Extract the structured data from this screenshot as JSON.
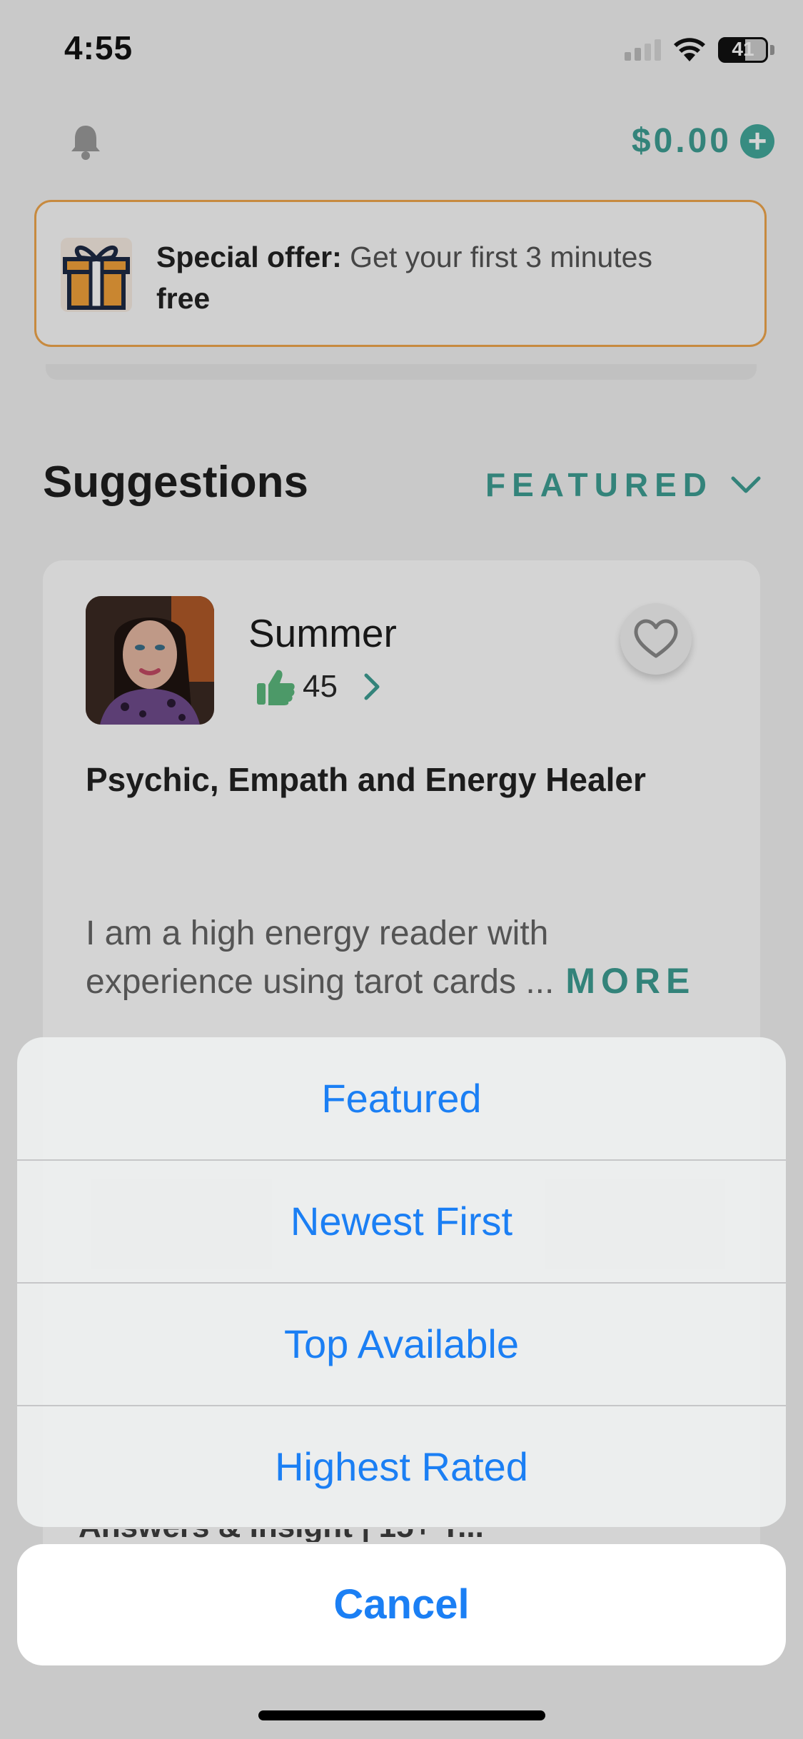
{
  "status_bar": {
    "time": "4:55",
    "battery": "41"
  },
  "header": {
    "balance": "$0.00"
  },
  "offer": {
    "label": "Special offer:",
    "text": "Get your first 3 minutes",
    "bold_end": "free"
  },
  "suggestions": {
    "title": "Suggestions",
    "sort_label": "FEATURED",
    "card": {
      "name": "Summer",
      "rating_count": "45",
      "headline": "Psychic, Empath and Energy Healer",
      "description": "I am a high energy reader with experience using tarot cards ...",
      "more_label": "MORE",
      "peek_text": "Answers & Insight | 15+ Y..."
    }
  },
  "action_sheet": {
    "options": [
      {
        "label": "Featured"
      },
      {
        "label": "Newest First"
      },
      {
        "label": "Top Available"
      },
      {
        "label": "Highest Rated"
      }
    ],
    "cancel_label": "Cancel"
  },
  "colors": {
    "accent": "#3e9e93",
    "ios_blue": "#1b7ff4",
    "offer_border": "#f0a64c",
    "thumb_green": "#5cb87e"
  },
  "icons": [
    "bell-icon",
    "plus-circle-icon",
    "gift-icon",
    "chevron-down-icon",
    "thumbs-up-icon",
    "chevron-right-icon",
    "heart-icon",
    "wifi-icon",
    "battery-icon",
    "cellular-signal-icon"
  ]
}
